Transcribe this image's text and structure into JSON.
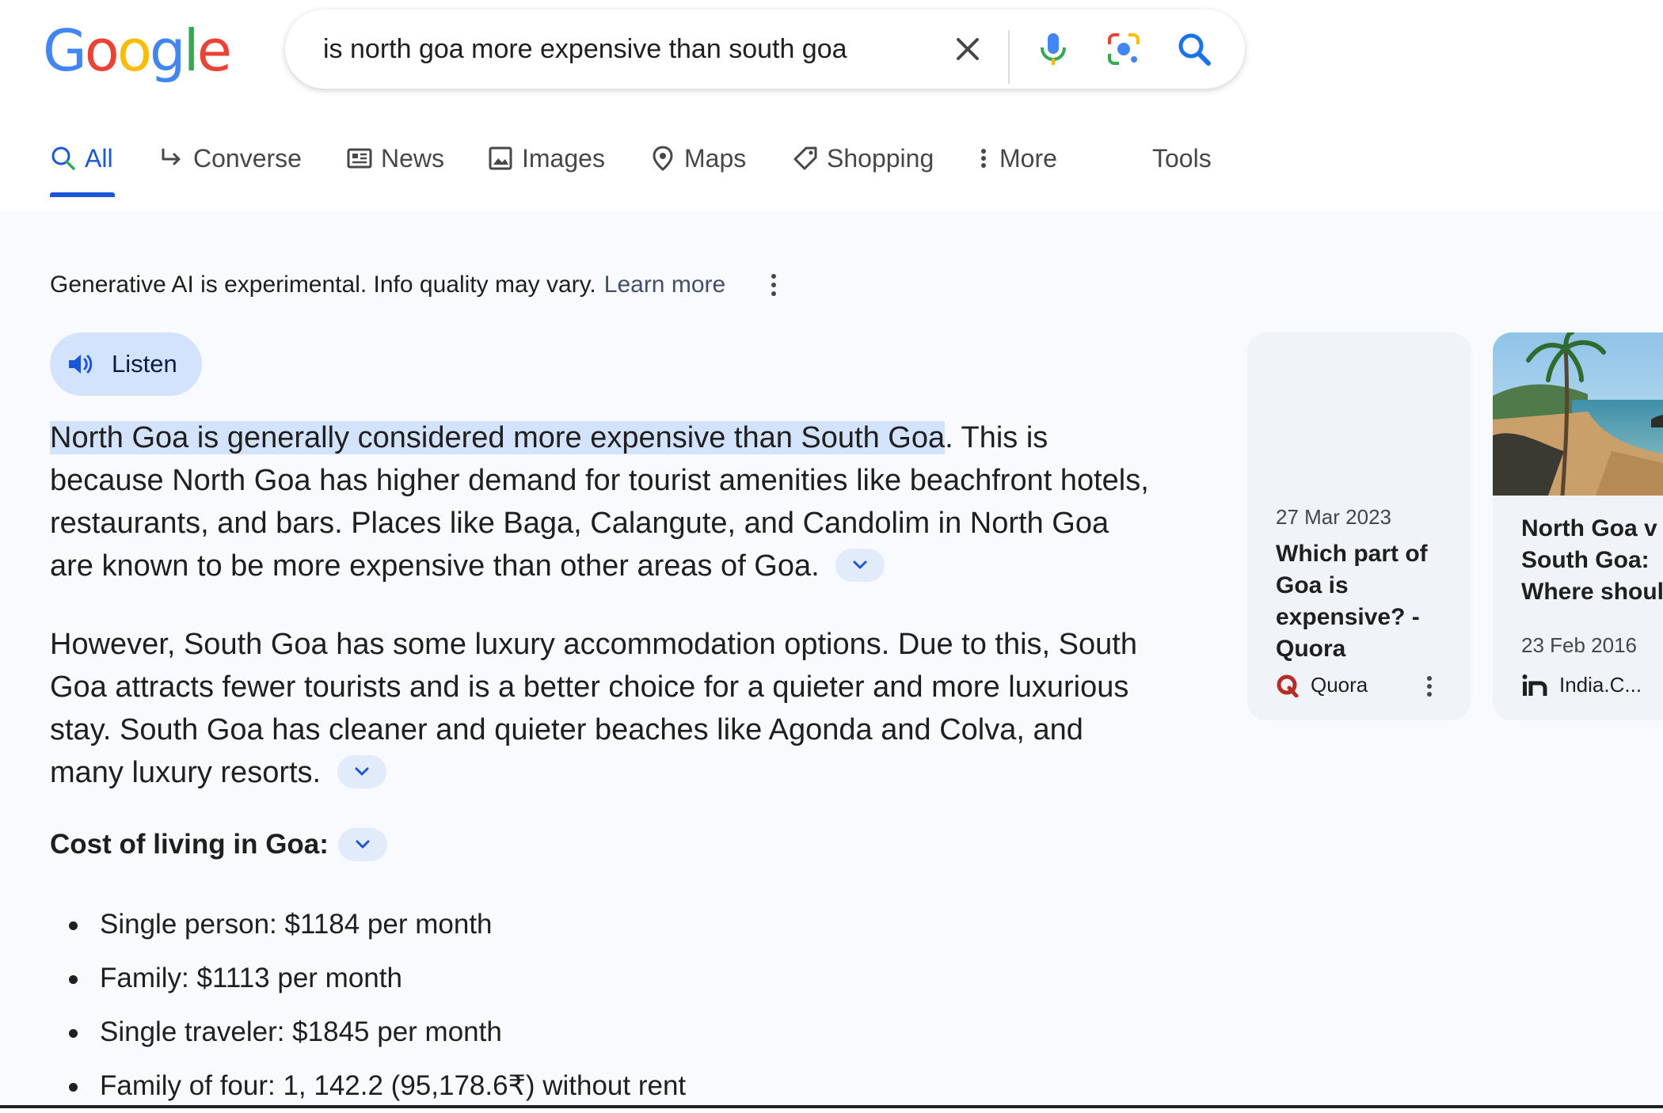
{
  "logo": {
    "text": "Google",
    "letters": [
      {
        "ch": "G",
        "color": "#4285F4"
      },
      {
        "ch": "o",
        "color": "#EA4335"
      },
      {
        "ch": "o",
        "color": "#FBBC05"
      },
      {
        "ch": "g",
        "color": "#4285F4"
      },
      {
        "ch": "l",
        "color": "#34A853"
      },
      {
        "ch": "e",
        "color": "#EA4335"
      }
    ]
  },
  "search": {
    "query": "is north goa more expensive than south goa",
    "icons": [
      "clear-icon",
      "microphone-icon",
      "lens-icon",
      "search-icon"
    ]
  },
  "tabs": [
    {
      "label": "All",
      "icon": "search-icon",
      "active": true
    },
    {
      "label": "Converse",
      "icon": "arrow-return-icon"
    },
    {
      "label": "News",
      "icon": "news-icon"
    },
    {
      "label": "Images",
      "icon": "image-icon"
    },
    {
      "label": "Maps",
      "icon": "map-pin-icon"
    },
    {
      "label": "Shopping",
      "icon": "tag-icon"
    },
    {
      "label": "More",
      "icon": "kebab-icon"
    },
    {
      "label": "Tools"
    }
  ],
  "ai": {
    "notice": "Generative AI is experimental. Info quality may vary.",
    "learn_more": "Learn more",
    "listen": "Listen",
    "p1_highlight": "North Goa is generally considered more expensive than South Goa",
    "p1_rest": ". This is because North Goa has higher demand for tourist amenities like beachfront hotels, restaurants, and bars. Places like Baga, Calangute, and Candolim in North Goa are known to be more expensive than other areas of Goa.",
    "p2": "However, South Goa has some luxury accommodation options. Due to this, South Goa attracts fewer tourists and is a better choice for a quieter and more luxurious stay. South Goa has cleaner and quieter beaches like Agonda and Colva, and many luxury resorts.",
    "cost_heading": "Cost of living in Goa:",
    "bullets": [
      "Single person: $1184 per month",
      "Family: $1113 per month",
      "Single traveler: $1845 per month",
      "Family of four: 1, 142.2 (95,178.6₹) without rent"
    ]
  },
  "cards": [
    {
      "date": "27 Mar 2023",
      "title": "Which part of\nGoa is\nexpensive? -\nQuora",
      "source": "Quora",
      "source_color": "#b92b27"
    },
    {
      "date": "23 Feb 2016",
      "title": "North Goa v\nSouth Goa:\nWhere shoul",
      "source": "India.C...",
      "image": "beach-photo"
    }
  ],
  "colors": {
    "accent": "#1a56d6",
    "panel_bg": "#f8fafd",
    "chip_bg": "#d3e3fd"
  }
}
